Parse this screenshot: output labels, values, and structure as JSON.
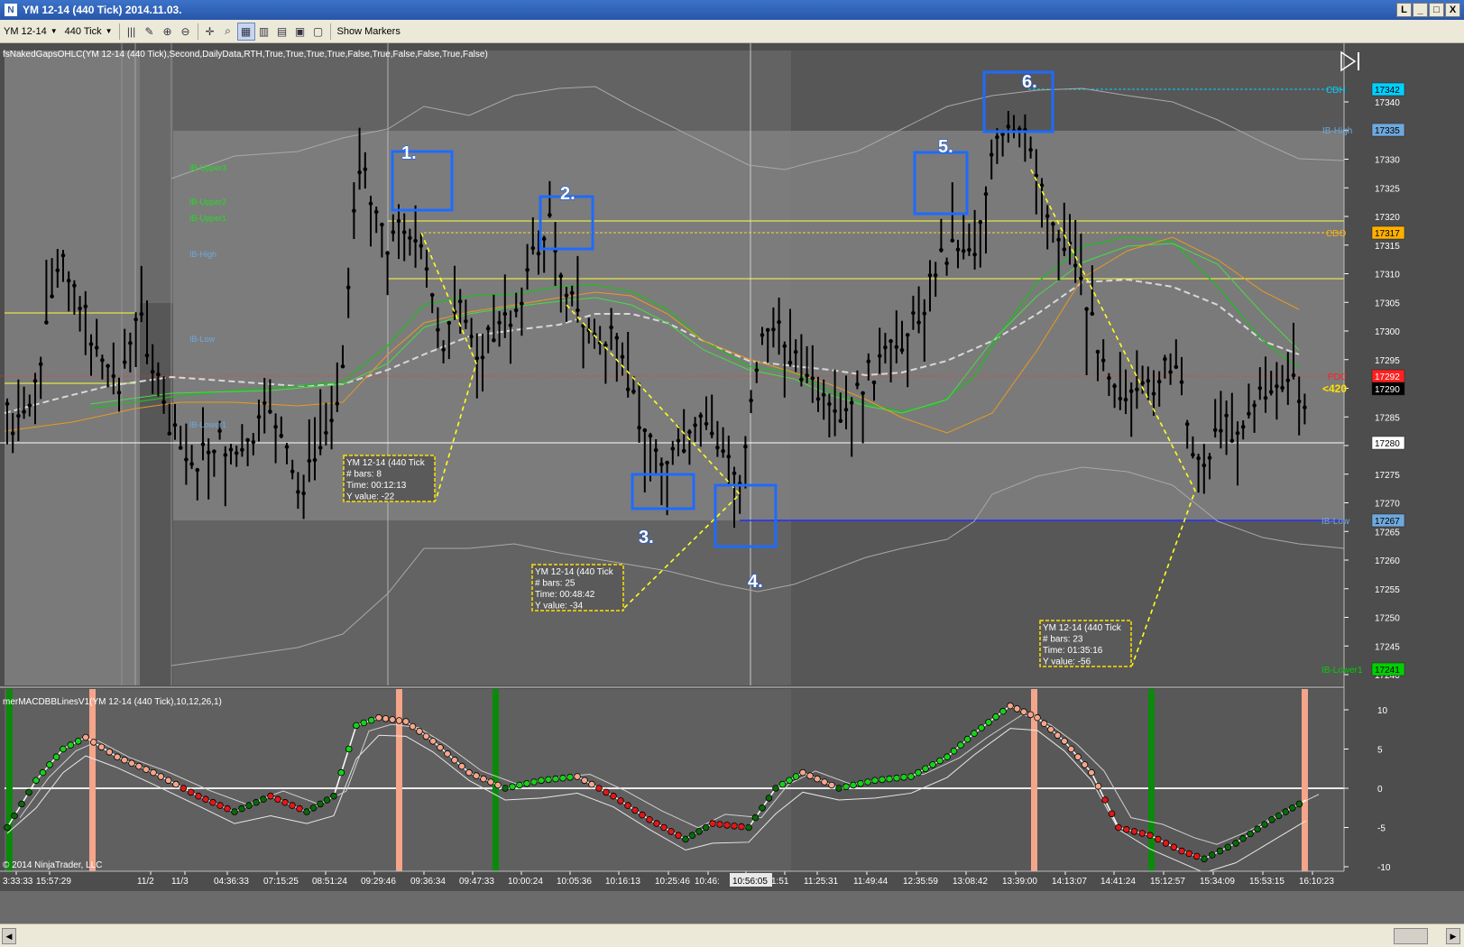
{
  "window": {
    "title": "YM 12-14 (440 Tick)  2014.11.03.",
    "buttons": {
      "restore": "L",
      "minimize": "_",
      "maximize": "□",
      "close": "X"
    }
  },
  "toolbar": {
    "instrument": "YM 12-14",
    "interval": "440 Tick",
    "show_markers": "Show Markers"
  },
  "chart": {
    "indicator_label": "fsNakedGapsOHLC(YM 12-14 (440 Tick),Second,DailyData,RTH,True,True,True,True,False,True,False,False,True,False)",
    "price_axis_ticks": [
      "17340",
      "17335",
      "17330",
      "17325",
      "17320",
      "17315",
      "17310",
      "17305",
      "17300",
      "17295",
      "17290",
      "17285",
      "17280",
      "17275",
      "17270",
      "17265",
      "17260",
      "17255",
      "17250",
      "17245",
      "17240"
    ],
    "tagged_prices": [
      {
        "label": "CDH",
        "value": "17342",
        "color": "#00d0ff"
      },
      {
        "label": "IB-High",
        "value": "17335",
        "color": "#6fa8dc"
      },
      {
        "label": "CDO",
        "value": "17317",
        "color": "#ffb000"
      },
      {
        "label": "PDC",
        "value": "17292",
        "color": "#ff2020"
      },
      {
        "label": "",
        "value": "17290",
        "color": "#000000"
      },
      {
        "label": "",
        "value": "17280",
        "color": "#ffffff"
      },
      {
        "label": "IB-Low",
        "value": "17267",
        "color": "#6fa8dc"
      },
      {
        "label": "IB-Lower1",
        "value": "17241",
        "color": "#00d000"
      }
    ],
    "tick_count": "<420",
    "left_levels": [
      "IB-Upper3",
      "IB-Upper2",
      "IB-Upper1",
      "IB-High",
      "IB-Low",
      "IB-Lower1"
    ],
    "markers": [
      "1.",
      "2.",
      "3.",
      "4.",
      "5.",
      "6."
    ],
    "info_boxes": [
      {
        "title": "YM 12-14 (440 Tick",
        "bars": "# bars:   8",
        "time": "Time:     00:12:13",
        "yvalue": "Y value: -22"
      },
      {
        "title": "YM 12-14 (440 Tick",
        "bars": "# bars:   25",
        "time": "Time:     00:48:42",
        "yvalue": "Y value: -34"
      },
      {
        "title": "YM 12-14 (440 Tick",
        "bars": "# bars:   23",
        "time": "Time:     01:35:16",
        "yvalue": "Y value: -56"
      }
    ]
  },
  "macd": {
    "label": "merMACDBBLinesV1(YM 12-14 (440 Tick),10,12,26,1)",
    "ticks": [
      "10",
      "5",
      "0",
      "-5",
      "-10"
    ],
    "copyright": "© 2014 NinjaTrader, LLC"
  },
  "time_axis": {
    "labels": [
      "3:33:33",
      "15:57:29",
      "11/2",
      "11/3",
      "04:36:33",
      "07:15:25",
      "08:51:24",
      "09:29:46",
      "09:36:34",
      "09:47:33",
      "10:00:24",
      "10:05:36",
      "10:16:13",
      "10:25:46",
      "10:46:",
      "10:56:05",
      "1:51",
      "11:25:31",
      "11:49:44",
      "12:35:59",
      "13:08:42",
      "13:39:00",
      "14:13:07",
      "14:41:24",
      "15:12:57",
      "15:34:09",
      "15:53:15",
      "16:10:23"
    ]
  },
  "colors": {
    "bg_outer": "#565656",
    "bg_ib": "#8a8a8a",
    "bar": "#000000",
    "marker_box": "#1e6bff",
    "marker_text": "#ffffff",
    "info_border": "#ffe000",
    "green_dot": "#18d018",
    "red_dot": "#e01818",
    "salmon_dot": "#f4a58a"
  }
}
